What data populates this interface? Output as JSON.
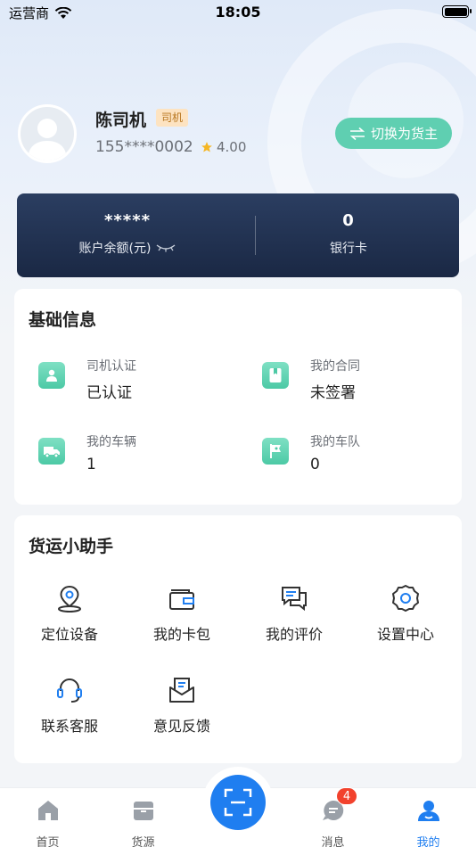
{
  "status_bar": {
    "carrier": "运营商",
    "time": "18:05"
  },
  "profile": {
    "name": "陈司机",
    "role_badge": "司机",
    "phone": "155****0002",
    "rating": "4.00",
    "switch_button": "切换为货主"
  },
  "balance": {
    "amount": "*****",
    "amount_label": "账户余额(元)",
    "bank_cards": "0",
    "bank_cards_label": "银行卡"
  },
  "basic_info": {
    "title": "基础信息",
    "items": [
      {
        "label": "司机认证",
        "value": "已认证",
        "icon": "driver-id-icon"
      },
      {
        "label": "我的合同",
        "value": "未签署",
        "icon": "contract-icon"
      },
      {
        "label": "我的车辆",
        "value": "1",
        "icon": "truck-icon"
      },
      {
        "label": "我的车队",
        "value": "0",
        "icon": "fleet-flag-icon"
      }
    ]
  },
  "assistant": {
    "title": "货运小助手",
    "tools": [
      {
        "label": "定位设备",
        "icon": "location-pin-icon"
      },
      {
        "label": "我的卡包",
        "icon": "wallet-icon"
      },
      {
        "label": "我的评价",
        "icon": "review-chat-icon"
      },
      {
        "label": "设置中心",
        "icon": "gear-icon"
      },
      {
        "label": "联系客服",
        "icon": "headset-icon"
      },
      {
        "label": "意见反馈",
        "icon": "feedback-mail-icon"
      }
    ]
  },
  "tab_bar": {
    "tabs": [
      {
        "label": "首页",
        "icon": "home-icon"
      },
      {
        "label": "货源",
        "icon": "cargo-box-icon"
      },
      {
        "label": "消息",
        "icon": "message-icon"
      },
      {
        "label": "我的",
        "icon": "profile-icon"
      }
    ],
    "message_badge": "4",
    "active": "我的"
  },
  "colors": {
    "accent": "#1f7ef0",
    "switch_button": "#5fcfb1",
    "card_dark": "#1a2844",
    "badge_red": "#f2422d",
    "role_badge_bg": "#fde3c1"
  }
}
